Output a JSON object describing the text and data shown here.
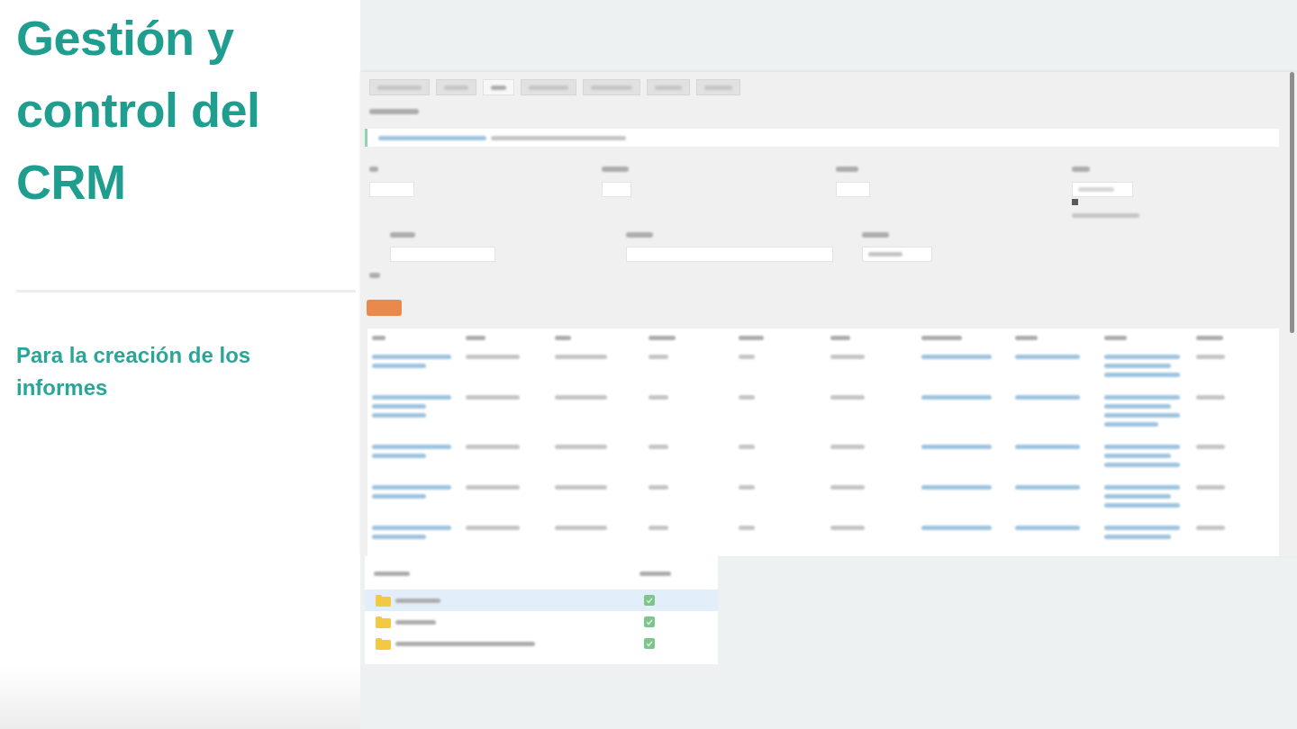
{
  "slide": {
    "title": "Gestión y control del CRM",
    "subtitle": "Para la creación de los informes"
  },
  "app": {
    "tabs": [
      {
        "selected": false
      },
      {
        "selected": false
      },
      {
        "selected": true
      },
      {
        "selected": false
      },
      {
        "selected": false
      },
      {
        "selected": false
      },
      {
        "selected": false
      }
    ],
    "option": {
      "checked": true
    },
    "table": {
      "columns": [
        {
          "kind": "link"
        },
        {
          "kind": "text"
        },
        {
          "kind": "text"
        },
        {
          "kind": "text"
        },
        {
          "kind": "text"
        },
        {
          "kind": "text"
        },
        {
          "kind": "link"
        },
        {
          "kind": "link"
        },
        {
          "kind": "link"
        },
        {
          "kind": "text"
        }
      ]
    },
    "folders": [
      {
        "selected": true
      },
      {
        "selected": false
      },
      {
        "selected": false
      }
    ]
  }
}
